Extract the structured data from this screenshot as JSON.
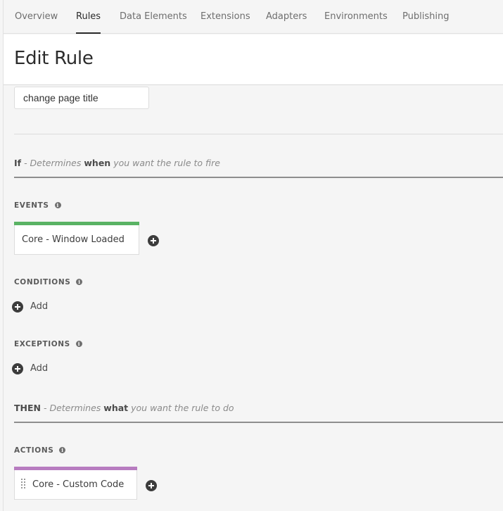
{
  "nav": {
    "tabs": [
      {
        "label": "Overview",
        "active": false
      },
      {
        "label": "Rules",
        "active": true
      },
      {
        "label": "Data Elements",
        "active": false
      },
      {
        "label": "Extensions",
        "active": false
      },
      {
        "label": "Adapters",
        "active": false
      },
      {
        "label": "Environments",
        "active": false
      },
      {
        "label": "Publishing",
        "active": false
      }
    ]
  },
  "header": {
    "title": "Edit Rule"
  },
  "rule_name": {
    "value": "change page title"
  },
  "if_section": {
    "keyword": "If",
    "pre": "- Determines",
    "bold": "when",
    "post": "you want the rule to fire"
  },
  "events": {
    "label": "EVENTS",
    "items": [
      {
        "label": "Core - Window Loaded",
        "color": "#5ab364"
      }
    ]
  },
  "conditions": {
    "label": "CONDITIONS",
    "add_label": "Add"
  },
  "exceptions": {
    "label": "EXCEPTIONS",
    "add_label": "Add"
  },
  "then_section": {
    "keyword": "THEN",
    "pre": "- Determines",
    "bold": "what",
    "post": "you want the rule to do"
  },
  "actions": {
    "label": "ACTIONS",
    "items": [
      {
        "label": "Core - Custom Code",
        "color": "#b77cc0"
      }
    ]
  },
  "icons": {
    "info": "info-icon",
    "add": "plus-circle-icon",
    "drag": "drag-handle-icon"
  }
}
